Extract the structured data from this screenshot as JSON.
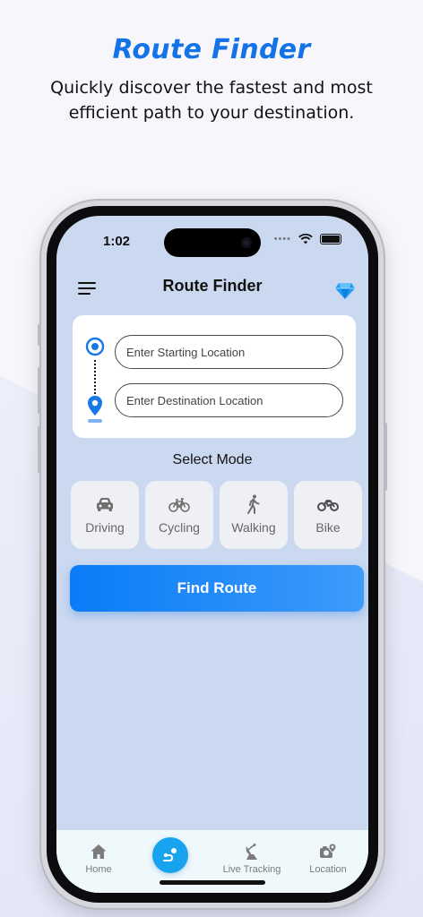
{
  "promo": {
    "headline": "Route Finder",
    "subline": "Quickly discover the fastest and most efficient path to your destination."
  },
  "status_bar": {
    "time": "1:02"
  },
  "nav": {
    "title": "Route Finder",
    "menu_icon": "hamburger-menu-icon",
    "premium_icon": "diamond-icon"
  },
  "route_form": {
    "start_placeholder": "Enter Starting Location",
    "destination_placeholder": "Enter Destination Location"
  },
  "mode_section": {
    "label": "Select Mode",
    "modes": [
      {
        "label": "Driving",
        "icon": "car-icon"
      },
      {
        "label": "Cycling",
        "icon": "bicycle-icon"
      },
      {
        "label": "Walking",
        "icon": "walking-icon"
      },
      {
        "label": "Bike",
        "icon": "motorbike-icon"
      }
    ]
  },
  "actions": {
    "find_route_label": "Find Route"
  },
  "tab_bar": {
    "items": [
      {
        "label": "Home",
        "icon": "home-icon"
      },
      {
        "label": "",
        "icon": "route-icon"
      },
      {
        "label": "Live Tracking",
        "icon": "satellite-dish-icon"
      },
      {
        "label": "Location",
        "icon": "camera-location-icon"
      }
    ]
  },
  "colors": {
    "accent": "#1473e6",
    "button": "#0a7cf7",
    "screen_bg": "#cbd9f0",
    "tab_bar_bg": "#eff8fb",
    "tab_center": "#18a3ee"
  }
}
